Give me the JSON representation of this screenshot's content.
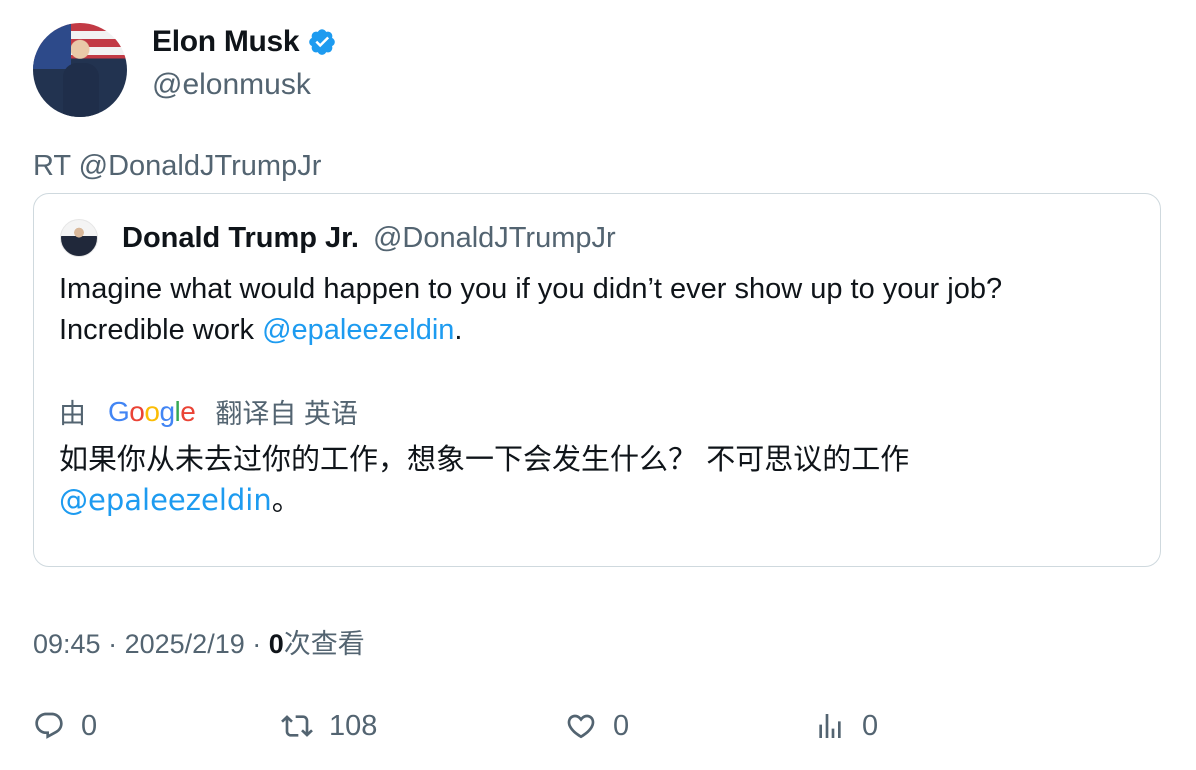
{
  "author": {
    "name": "Elon Musk",
    "handle": "@elonmusk",
    "verified_color": "#1d9bf0"
  },
  "retweet_line": "RT @DonaldJTrumpJr",
  "quoted": {
    "name": "Donald Trump Jr.",
    "handle": "@DonaldJTrumpJr",
    "text_line1": "Imagine what would happen to you if you didn’t ever show up to your job?",
    "text_line2_prefix": "Incredible work ",
    "mention": "@epaleezeldin",
    "text_line2_suffix": ".",
    "translation": {
      "by": "由",
      "google_letters": [
        "G",
        "o",
        "o",
        "g",
        "l",
        "e"
      ],
      "translated_from": "翻译自 英语",
      "text_line1": "如果你从未去过你的工作，想象一下会发生什么？ 不可思议的工作",
      "mention": "@epaleezeldin",
      "text_suffix": "。"
    }
  },
  "meta": {
    "time": "09:45",
    "separator": "·",
    "date": "2025/2/19",
    "views_count": "0",
    "views_label": "次查看"
  },
  "actions": {
    "replies": "0",
    "retweets": "108",
    "likes": "0",
    "views": "0"
  },
  "colors": {
    "text": "#0f1419",
    "secondary": "#536471",
    "link": "#1d9bf0",
    "border": "#cfd9de"
  }
}
